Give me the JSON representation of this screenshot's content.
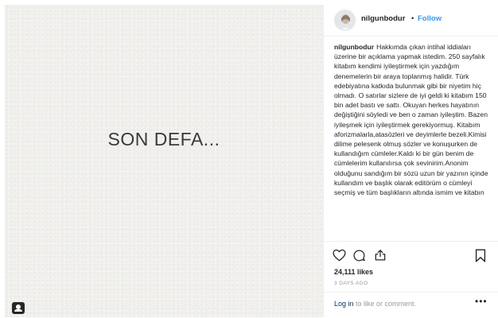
{
  "post": {
    "media_text": "SON DEFA...",
    "username": "nilgunbodur",
    "separator": "•",
    "follow_label": "Follow",
    "caption_user": "nilgunbodur",
    "caption_text": "Hakkımda çıkan intihal iddiaları üzerine bir açıklama yapmak istedim. 250 sayfalık kitabım kendimi iyileştirmek için yazdığım denemelerin bir araya toplanmış halidir. Türk edebiyatına katkıda bulunmak gibi bir niyetim hiç olmadı. O satırlar sizlere de iyi geldi ki kitabım 150 bin adet bastı ve sattı. Okuyan herkes hayatının değiştiğini söyledi ve ben o zaman iyileştim. Bazen iyileşmek için iyileştirmek gerekiyormuş. Kitabım aforizmalarla,atasözleri ve deyimlerle bezeli.Kimisi dilime pelesenk olmuş sözler ve konuşurken de kullandığım cümleler.Kaldı ki bir gün benim de cümlelerim kullanılırsa çok sevinirim.Anonim olduğunu sandığım bir sözü uzun bir yazının içinde kullandım ve başlık olarak editörüm o cümleyi seçmiş ve tüm başlıkların altında ismim ve kitabın",
    "likes": "24,111 likes",
    "time_ago": "3 DAYS AGO",
    "login_link": "Log in",
    "login_text": "to like or comment.",
    "more_label": "•••"
  },
  "icons": {
    "tag": "user-tag-icon",
    "like": "heart-icon",
    "comment": "comment-icon",
    "share": "share-icon",
    "save": "bookmark-icon"
  }
}
